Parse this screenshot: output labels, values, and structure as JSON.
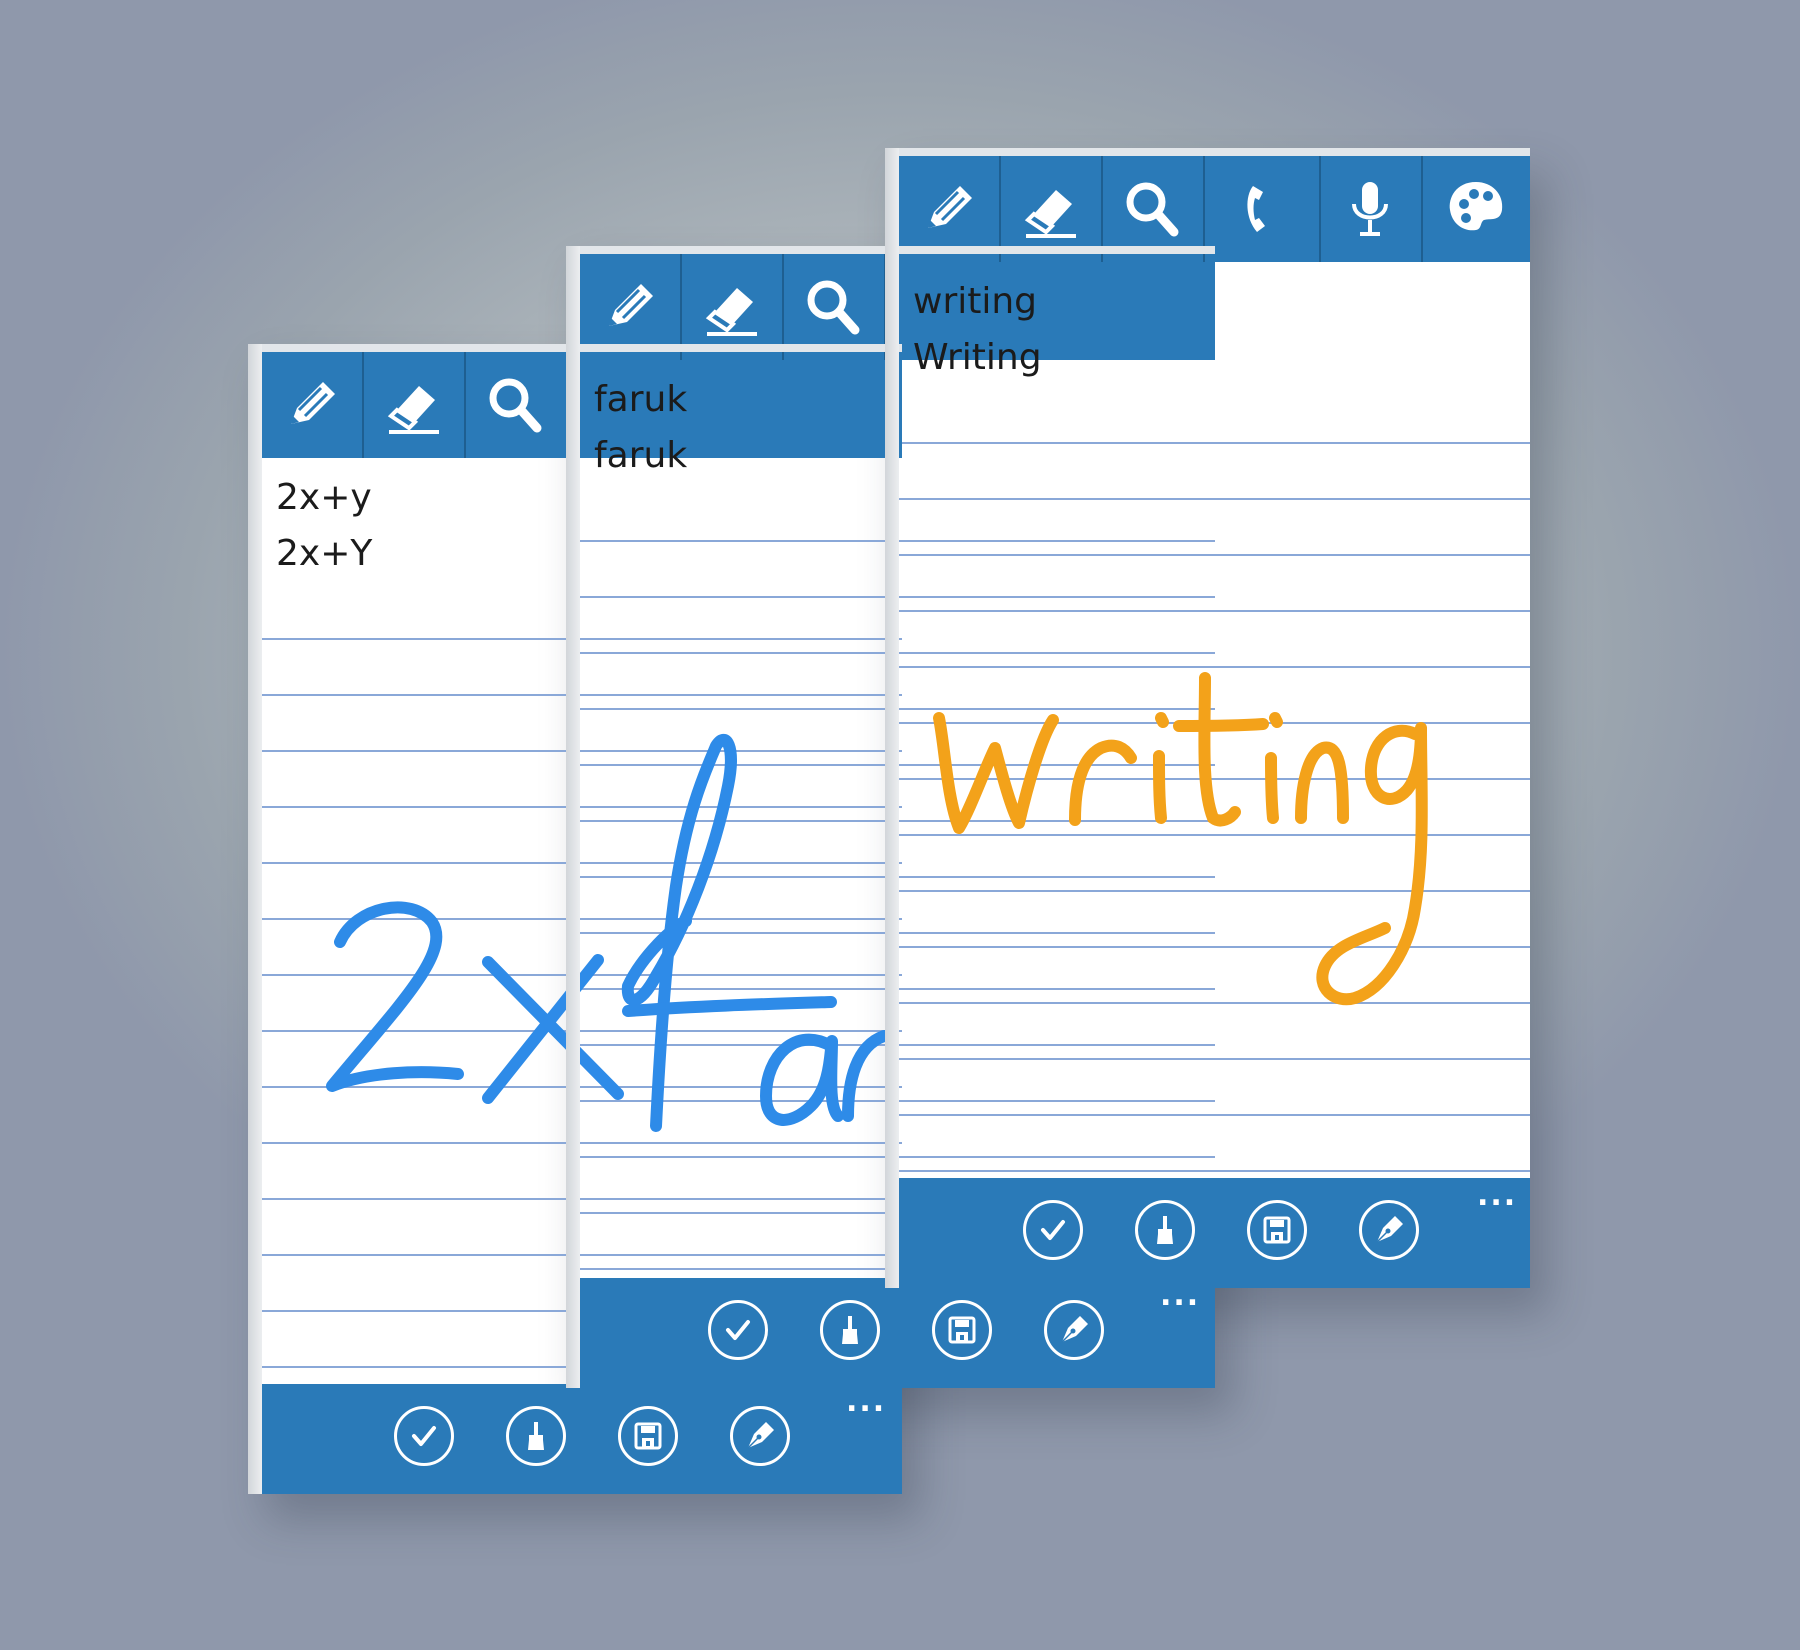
{
  "colors": {
    "toolbar": "#2a7ab8",
    "ink_blue": "#2e8be8",
    "ink_orange": "#f3a21a",
    "rule_line": "#8aa8d8"
  },
  "cards": [
    {
      "toolbar_icons": [
        "pencil-icon",
        "eraser-icon",
        "search-icon"
      ],
      "recognized": [
        "2x+y",
        "2x+Y"
      ],
      "handwriting_text": "2x",
      "bottom_icons": [
        "check-icon",
        "brush-icon",
        "save-icon",
        "pen-icon"
      ],
      "more": "..."
    },
    {
      "toolbar_icons": [
        "pencil-icon",
        "eraser-icon",
        "search-icon"
      ],
      "recognized": [
        "faruk",
        "faruk"
      ],
      "handwriting_text": "far",
      "bottom_icons": [
        "check-icon",
        "brush-icon",
        "save-icon",
        "pen-icon"
      ],
      "more": "..."
    },
    {
      "toolbar_icons": [
        "pencil-icon",
        "eraser-icon",
        "search-icon",
        "phone-icon",
        "microphone-icon",
        "palette-icon"
      ],
      "recognized": [
        "writing",
        "Writing"
      ],
      "handwriting_text": "writing",
      "bottom_icons": [
        "check-icon",
        "brush-icon",
        "save-icon",
        "pen-icon"
      ],
      "more": "..."
    }
  ]
}
